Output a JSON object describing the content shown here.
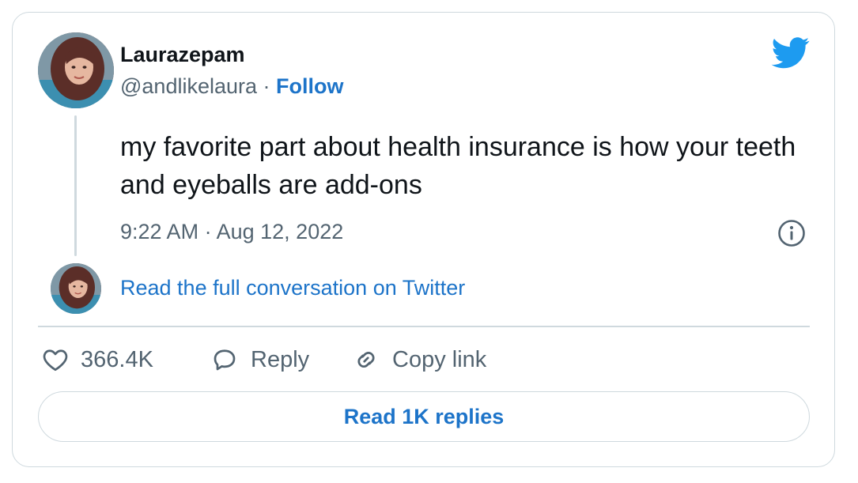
{
  "author": {
    "name": "Laurazepam",
    "handle": "@andlikelaura",
    "separator": "·",
    "follow_label": "Follow"
  },
  "tweet": {
    "text": "my favorite part about health insurance is how your teeth and eyeballs are add-ons",
    "time": "9:22 AM",
    "date_separator": "·",
    "date": "Aug 12, 2022"
  },
  "conversation": {
    "link_label": "Read the full conversation on Twitter"
  },
  "actions": {
    "likes_count": "366.4K",
    "reply_label": "Reply",
    "copy_link_label": "Copy link"
  },
  "replies_button": {
    "label": "Read 1K replies"
  },
  "colors": {
    "accent": "#1d74c9",
    "twitter_blue": "#1d9bf0",
    "muted": "#536471",
    "border": "#cfd9de"
  }
}
